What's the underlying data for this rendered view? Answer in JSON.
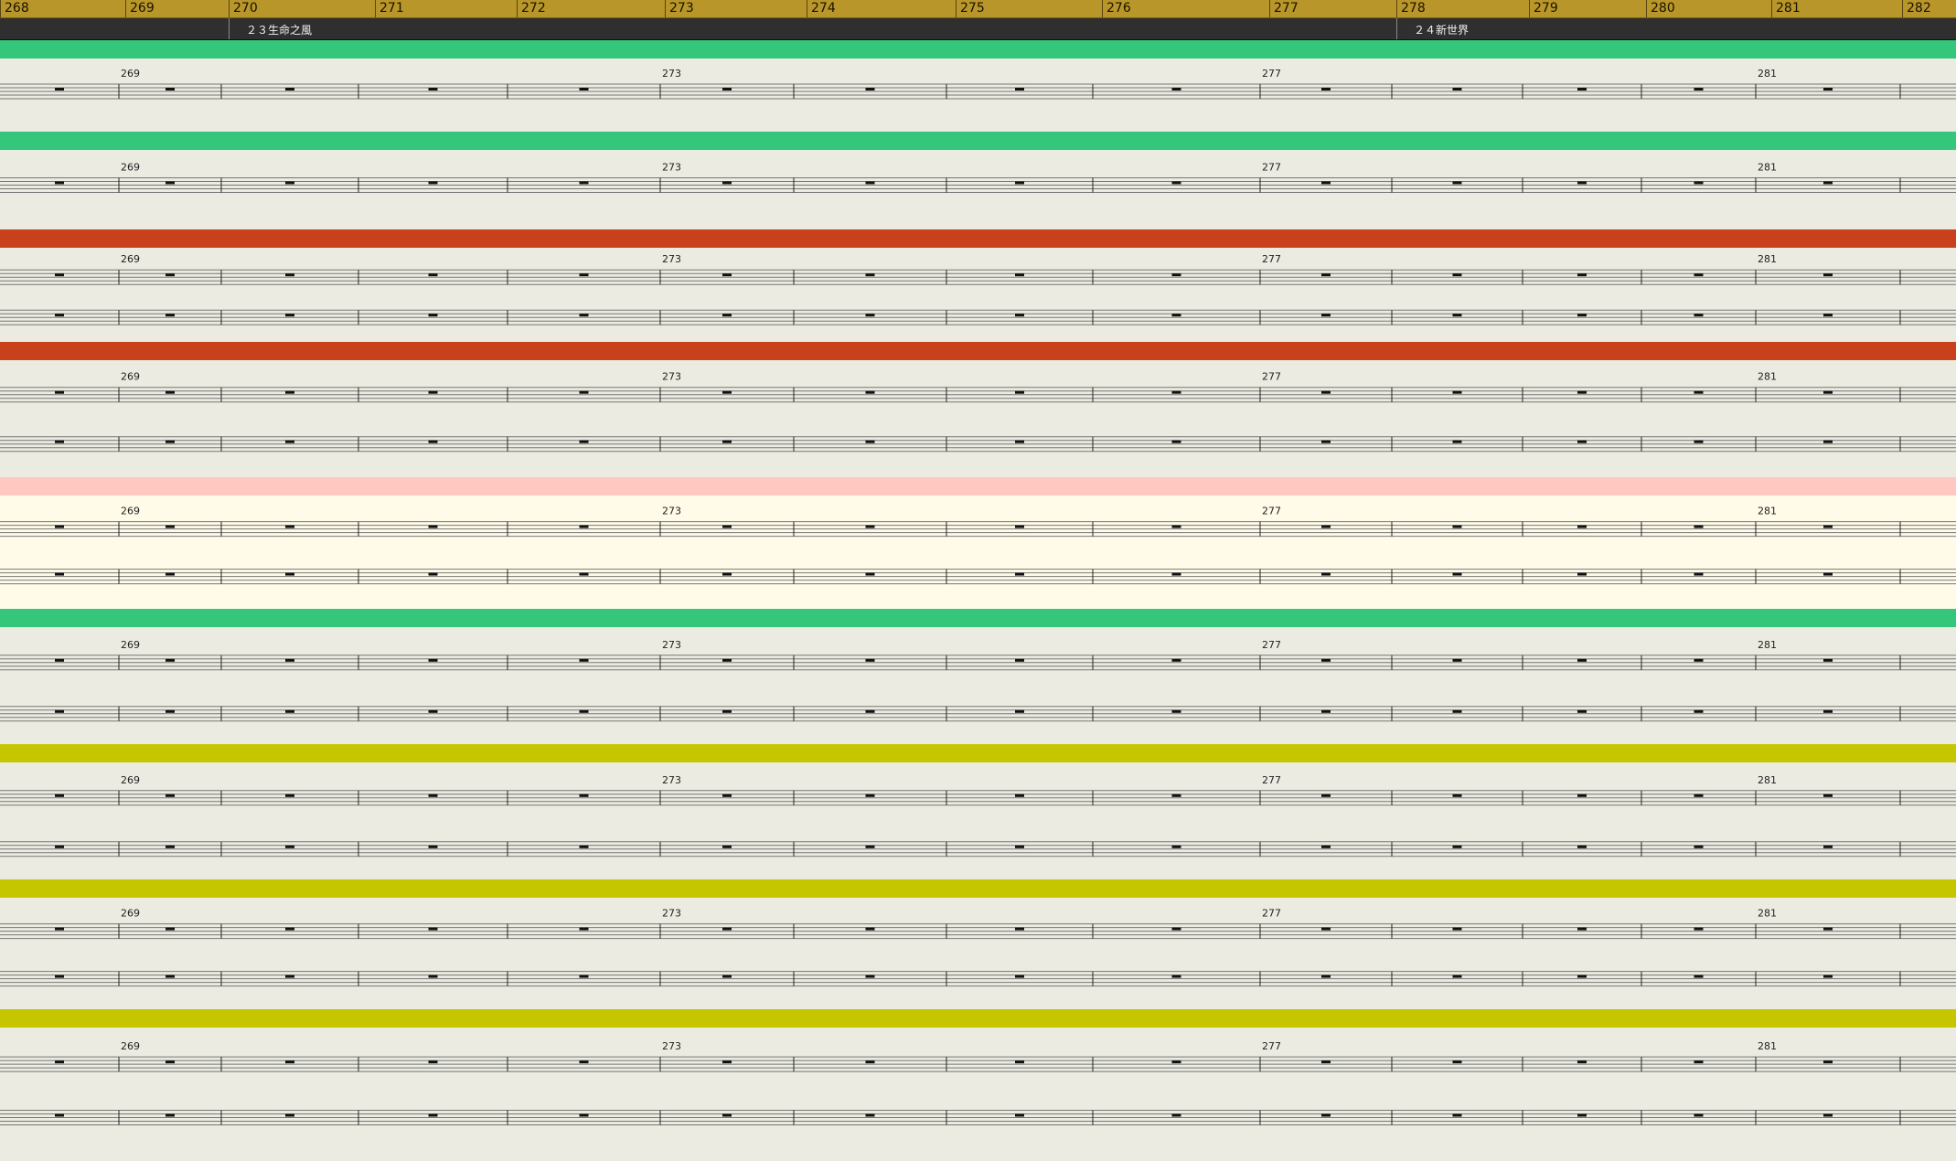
{
  "ruler": {
    "measures": [
      "268",
      "269",
      "270",
      "271",
      "272",
      "273",
      "274",
      "275",
      "276",
      "277",
      "278",
      "279",
      "280",
      "281",
      "282"
    ]
  },
  "markers": [
    {
      "label": "２３生命之風"
    },
    {
      "label": "２４新世界"
    }
  ],
  "colors": {
    "green": "#34c67a",
    "red": "#c8401c",
    "pink": "#ffc8c0",
    "yellow": "#c6c600",
    "ruler": "#b8962a",
    "marker_bar": "#2f2f2f"
  },
  "tracks": [
    {
      "color": "green",
      "staves": 1,
      "measure_numbers": [
        "269",
        "273",
        "277",
        "281"
      ]
    },
    {
      "color": "green",
      "staves": 1,
      "measure_numbers": [
        "269",
        "273",
        "277",
        "281"
      ]
    },
    {
      "color": "red",
      "staves": 2,
      "measure_numbers": [
        "269",
        "273",
        "277",
        "281"
      ]
    },
    {
      "color": "red",
      "staves": 2,
      "measure_numbers": [
        "269",
        "273",
        "277",
        "281"
      ]
    },
    {
      "color": "pink",
      "staves": 2,
      "measure_numbers": [
        "269",
        "273",
        "277",
        "281"
      ]
    },
    {
      "color": "green",
      "staves": 2,
      "measure_numbers": [
        "269",
        "273",
        "277",
        "281"
      ]
    },
    {
      "color": "yellow",
      "staves": 2,
      "measure_numbers": [
        "269",
        "273",
        "277",
        "281"
      ]
    },
    {
      "color": "yellow",
      "staves": 2,
      "measure_numbers": [
        "269",
        "273",
        "277",
        "281"
      ]
    },
    {
      "color": "yellow",
      "staves": 2,
      "measure_numbers": [
        "269",
        "273",
        "277",
        "281"
      ]
    }
  ]
}
